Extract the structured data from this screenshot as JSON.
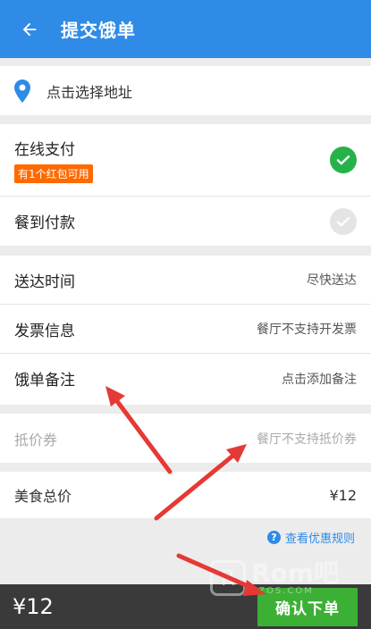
{
  "header": {
    "title": "提交饿单",
    "back_icon": "arrow-left-icon"
  },
  "address": {
    "text": "点击选择地址",
    "icon": "location-pin-icon"
  },
  "payment": {
    "online": {
      "label": "在线支付",
      "badge": "有1个红包可用",
      "selected": true
    },
    "on_arrival": {
      "label": "餐到付款",
      "selected": false
    }
  },
  "info": [
    {
      "label": "送达时间",
      "value": "尽快送达"
    },
    {
      "label": "发票信息",
      "value": "餐厅不支持开发票"
    },
    {
      "label": "饿单备注",
      "value": "点击添加备注"
    }
  ],
  "coupon": {
    "label": "抵价券",
    "value": "餐厅不支持抵价券"
  },
  "total": {
    "label": "美食总价",
    "value": "¥12"
  },
  "promo_link": {
    "text": "查看优惠规则",
    "icon": "question-circle-icon"
  },
  "bottom": {
    "total": "¥12",
    "confirm_label": "确认下单"
  },
  "watermark": {
    "brand": "Rom吧",
    "url": "YZOS.COM"
  },
  "colors": {
    "primary": "#2f8be6",
    "confirm": "#3cb035",
    "badge": "#ff6a00",
    "check_on": "#25b24b",
    "annotation": "#e53935"
  }
}
